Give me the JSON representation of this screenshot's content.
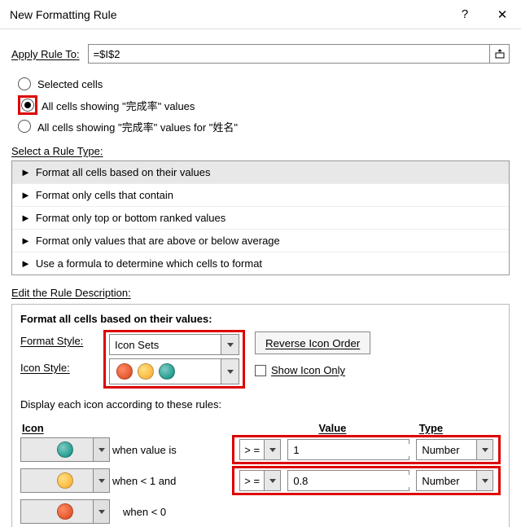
{
  "titlebar": {
    "title": "New Formatting Rule"
  },
  "apply": {
    "label": "Apply Rule To:",
    "value": "=$I$2"
  },
  "radios": {
    "selected_cells": "Selected cells",
    "all_showing_1": "All cells showing \"完成率\" values",
    "all_showing_2": "All cells showing \"完成率\" values for \"姓名\""
  },
  "rule_type": {
    "label": "Select a Rule Type:",
    "items": [
      "Format all cells based on their values",
      "Format only cells that contain",
      "Format only top or bottom ranked values",
      "Format only values that are above or below average",
      "Use a formula to determine which cells to format"
    ]
  },
  "desc": {
    "label": "Edit the Rule Description:",
    "heading": "Format all cells based on their values:",
    "format_style_label": "Format Style:",
    "format_style_value": "Icon Sets",
    "reverse_btn": "Reverse Icon Order",
    "icon_style_label": "Icon Style:",
    "show_icon_only": "Show Icon Only",
    "display_rules_label": "Display each icon according to these rules:",
    "cols": {
      "icon": "Icon",
      "value": "Value",
      "type": "Type"
    },
    "rows": [
      {
        "icon": "green",
        "cond": "when value is",
        "op": "> =",
        "val": "1",
        "type": "Number"
      },
      {
        "icon": "yellow",
        "cond": "when < 1 and",
        "op": "> =",
        "val": "0.8",
        "type": "Number"
      },
      {
        "icon": "red",
        "cond": "when < 0",
        "op": "",
        "val": "",
        "type": ""
      }
    ]
  }
}
